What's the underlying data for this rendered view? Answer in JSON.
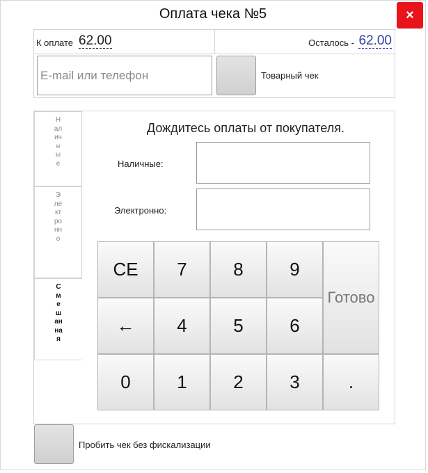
{
  "dialog": {
    "title": "Оплата чека №5",
    "close_icon": "×"
  },
  "summary": {
    "to_pay_label": "К оплате",
    "to_pay_value": "62.00",
    "remaining_label": "Осталось -",
    "remaining_value": "62.00"
  },
  "contact": {
    "placeholder": "E-mail или телефон",
    "value": ""
  },
  "receipt": {
    "label": "Товарный чек",
    "checked": false
  },
  "tabs": [
    {
      "label": "Наличные",
      "active": false
    },
    {
      "label": "Электронно",
      "active": false
    },
    {
      "label": "Смешанная",
      "active": true
    }
  ],
  "payment": {
    "wait_message": "Дождитесь оплаты от покупателя.",
    "cash_label": "Наличные:",
    "cash_value": "",
    "electronic_label": "Электронно:",
    "electronic_value": ""
  },
  "keypad": {
    "ce": "CE",
    "k7": "7",
    "k8": "8",
    "k9": "9",
    "done": "Готово",
    "back": "←",
    "k4": "4",
    "k5": "5",
    "k6": "6",
    "k0": "0",
    "k1": "1",
    "k2": "2",
    "k3": "3",
    "dot": "."
  },
  "fiscal": {
    "label": "Пробить чек без фискализации",
    "checked": false
  },
  "colors": {
    "close_bg": "#e8141b",
    "remaining_value": "#2f3f9e"
  }
}
